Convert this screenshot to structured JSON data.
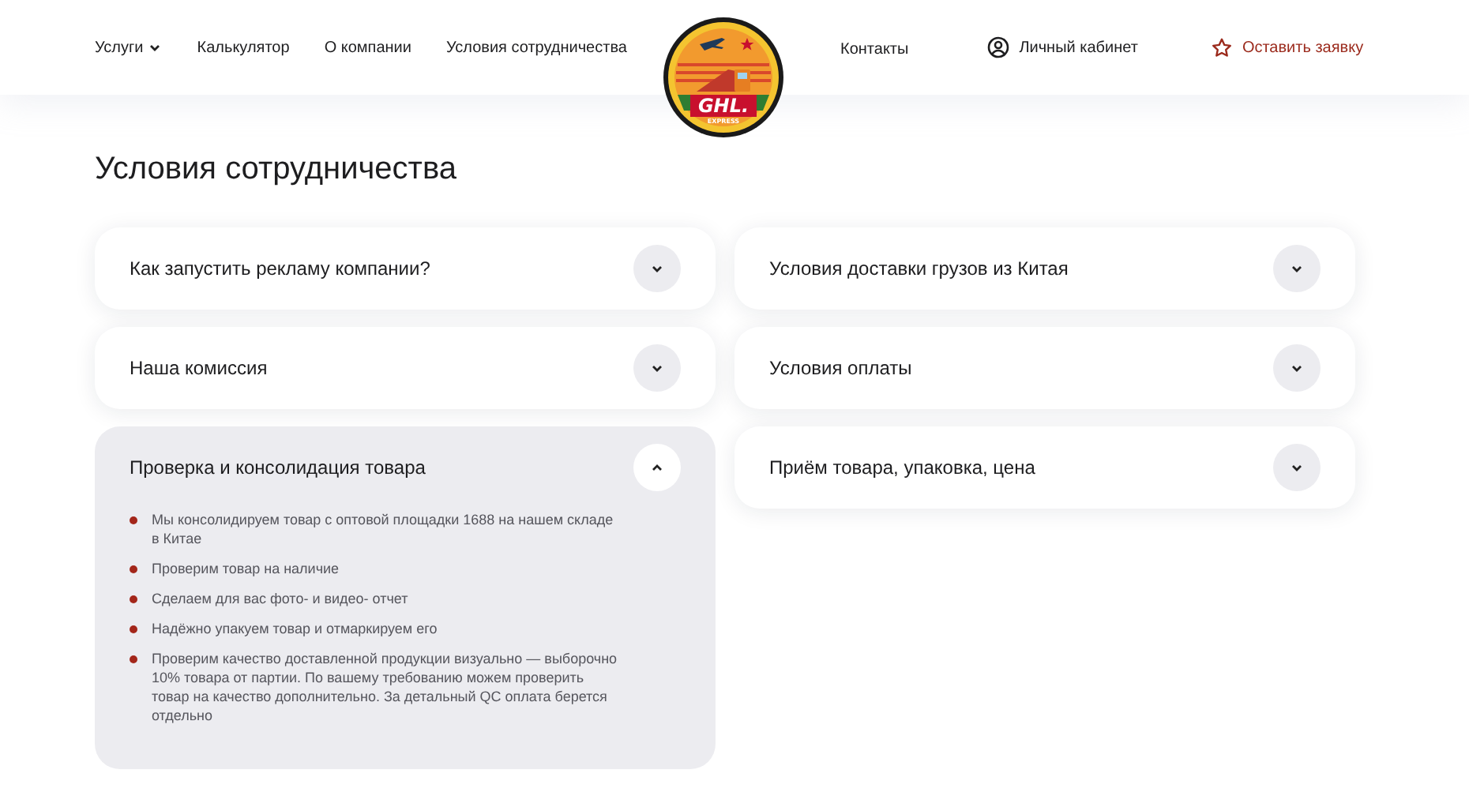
{
  "nav_left": [
    {
      "label": "Услуги",
      "kind": "dropdown"
    },
    {
      "label": "Калькулятор",
      "kind": "link"
    },
    {
      "label": "О компании",
      "kind": "link"
    },
    {
      "label": "Условия сотрудничества",
      "kind": "link"
    }
  ],
  "logo": {
    "title": "GHL.",
    "subtitle": "EXPRESS"
  },
  "nav_right": [
    {
      "label": "Контакты",
      "kind": "link"
    },
    {
      "label": "Личный кабинет",
      "kind": "account"
    },
    {
      "label": "Оставить заявку",
      "kind": "cta"
    }
  ],
  "page_title": "Условия сотрудничества",
  "columns": [
    [
      {
        "title": "Как запустить рекламу компании?",
        "expanded": false
      },
      {
        "title": "Наша комиссия",
        "expanded": false
      },
      {
        "title": "Проверка и консолидация товара",
        "expanded": true,
        "items": [
          "Мы консолидируем товар с оптовой площадки 1688 на нашем складе в Китае",
          "Проверим товар на наличие",
          "Сделаем для вас фото- и видео- отчет",
          "Надёжно упакуем товар и отмаркируем его",
          "Проверим качество доставленной продукции визуально — выборочно 10% товара от партии. По вашему требованию можем проверить товар на качество дополнительно. За детальный QC оплата берется отдельно"
        ]
      }
    ],
    [
      {
        "title": "Условия доставки грузов из Китая",
        "expanded": false
      },
      {
        "title": "Условия оплаты",
        "expanded": false
      },
      {
        "title": "Приём товара, упаковка, цена",
        "expanded": false
      }
    ]
  ]
}
